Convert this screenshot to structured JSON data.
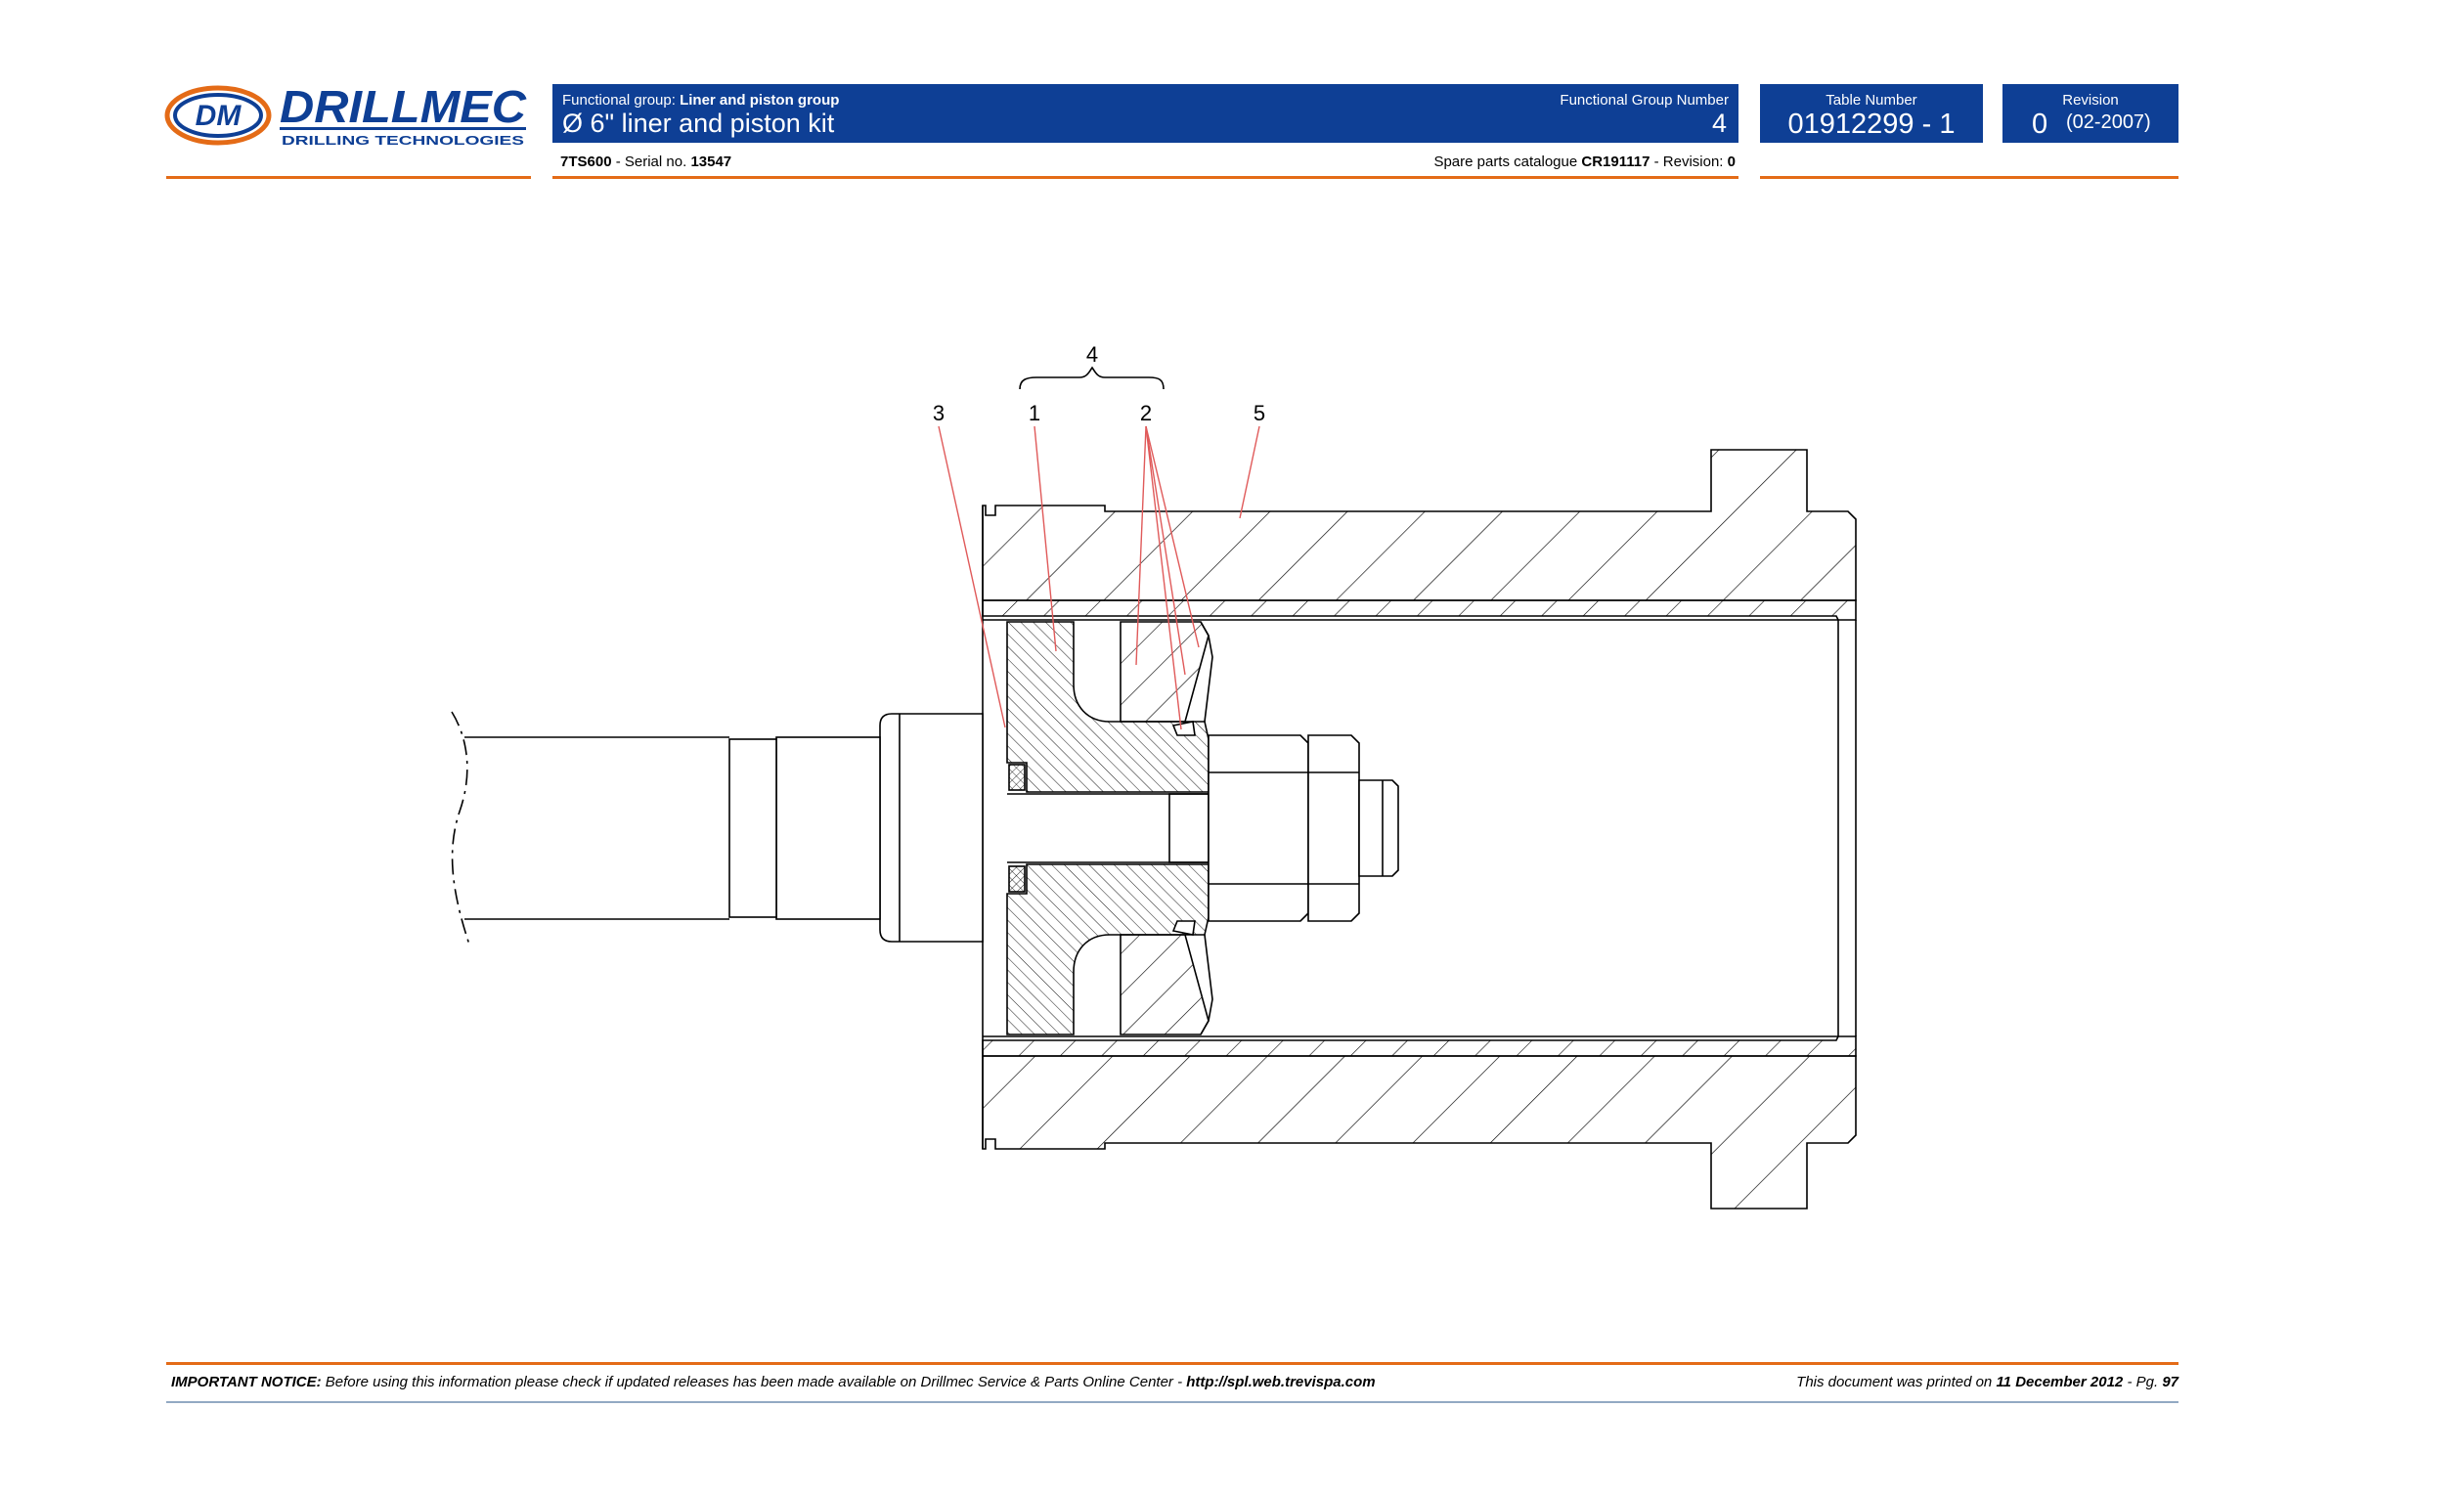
{
  "header": {
    "logo_text": "DRILLMEC",
    "logo_subtext": "DRILLING TECHNOLOGIES",
    "logo_monogram": "DM",
    "functional_group_label": "Functional group:",
    "functional_group_value": "Liner and piston group",
    "title": "Ø 6\" liner and piston kit",
    "functional_group_number_label": "Functional Group Number",
    "functional_group_number": "4",
    "table_number_label": "Table Number",
    "table_number": "01912299 - 1",
    "revision_label": "Revision",
    "revision_value": "0",
    "revision_date": "(02-2007)",
    "model": "7TS600",
    "serial_label": "- Serial no.",
    "serial_number": "13547",
    "catalogue_label": "Spare parts catalogue",
    "catalogue_code": "CR191117",
    "catalogue_revision_label": "- Revision:",
    "catalogue_revision": "0"
  },
  "drawing": {
    "callouts": [
      "3",
      "1",
      "2",
      "5",
      "4"
    ]
  },
  "footer": {
    "notice_label": "IMPORTANT NOTICE:",
    "notice_text": "Before using this information please check if updated releases has been made available on Drillmec Service & Parts Online Center -",
    "notice_url": "http://spl.web.trevispa.com",
    "printed_label": "This document was printed on",
    "printed_date": "11 December 2012",
    "page_label": "- Pg.",
    "page_number": "97"
  },
  "colors": {
    "header_blue": "#0e3f95",
    "accent_orange": "#e46b17",
    "leader_red": "#e05a5a",
    "footer_rule_blue": "#93a9c3"
  }
}
